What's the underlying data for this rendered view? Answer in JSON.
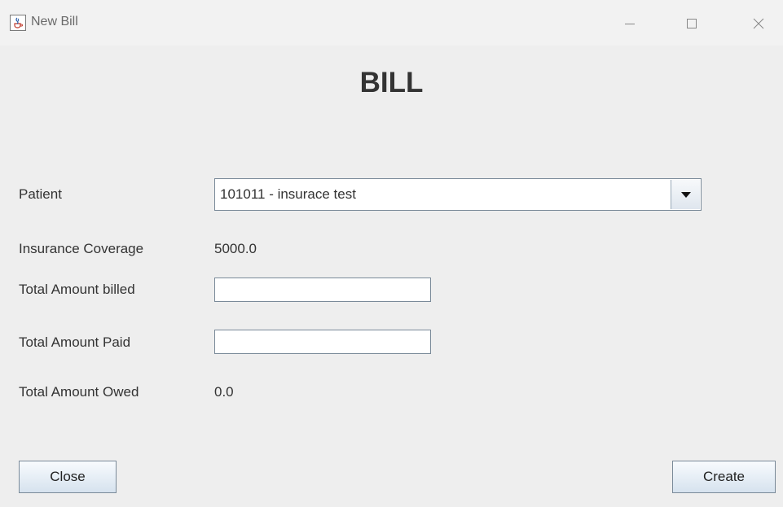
{
  "window": {
    "title": "New Bill",
    "icon": "java-coffee-icon",
    "controls": {
      "minimize": "minimize-icon",
      "maximize": "maximize-icon",
      "close": "close-icon"
    }
  },
  "heading": "BILL",
  "form": {
    "patient_label": "Patient",
    "patient_selected": "101011 - insurace test",
    "insurance_label": "Insurance Coverage",
    "insurance_value": "5000.0",
    "billed_label": "Total Amount billed",
    "billed_value": "",
    "paid_label": "Total Amount Paid",
    "paid_value": "",
    "owed_label": "Total Amount Owed",
    "owed_value": "0.0"
  },
  "buttons": {
    "close_label": "Close",
    "create_label": "Create"
  },
  "colors": {
    "background": "#eeeeee",
    "titlebar": "#f2f2f2",
    "field_border": "#7a8a99"
  }
}
